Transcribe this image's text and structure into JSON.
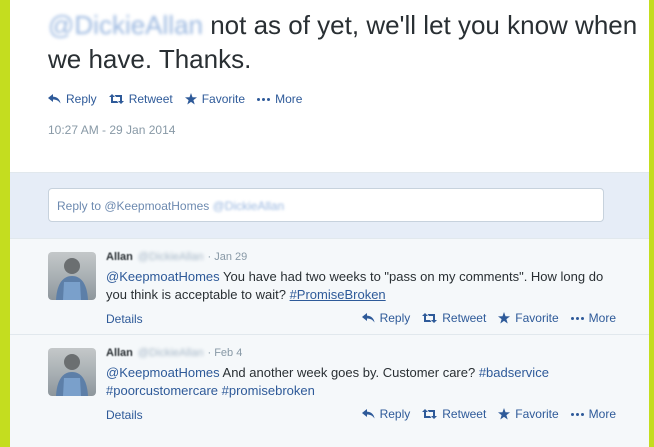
{
  "main_tweet": {
    "mention": "@DickieAllan",
    "text": " not as of yet, we'll let you know when we have. Thanks.",
    "actions": {
      "reply": "Reply",
      "retweet": "Retweet",
      "favorite": "Favorite",
      "more": "More"
    },
    "timestamp": "10:27 AM - 29 Jan 2014"
  },
  "reply_box": {
    "placeholder_prefix": "Reply to @KeepmoatHomes",
    "placeholder_blurred": "@DickieAllan"
  },
  "replies": [
    {
      "name": "Allan",
      "handle": "@DickieAllan",
      "date": "· Jan 29",
      "mention": "@KeepmoatHomes",
      "text": " You have had two weeks to \"pass on my comments\". How long do you think is acceptable to wait? ",
      "hashtag": "#PromiseBroken",
      "details": "Details",
      "actions": {
        "reply": "Reply",
        "retweet": "Retweet",
        "favorite": "Favorite",
        "more": "More"
      }
    },
    {
      "name": "Allan",
      "handle": "@DickieAllan",
      "date": "· Feb 4",
      "mention": "@KeepmoatHomes",
      "text": " And another week goes by. Customer care? ",
      "hashtag1": "#badservice",
      "hashtag2": "#poorcustomercare",
      "hashtag3": "#promisebroken",
      "details": "Details",
      "actions": {
        "reply": "Reply",
        "retweet": "Retweet",
        "favorite": "Favorite",
        "more": "More"
      }
    }
  ],
  "colors": {
    "accent": "#2e5a99",
    "frame": "#c4dd1f",
    "text": "#292f33",
    "muted": "#8899a6"
  }
}
